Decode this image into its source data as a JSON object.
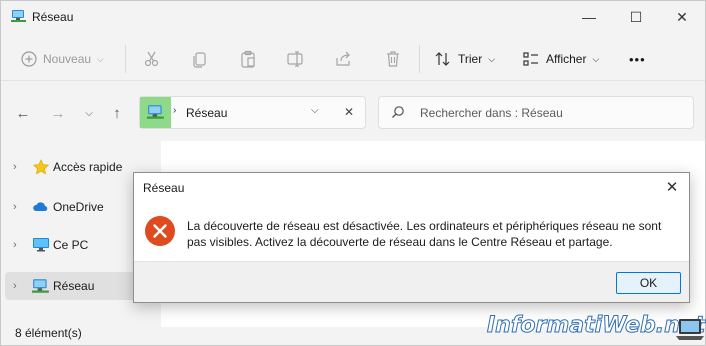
{
  "window": {
    "title": "Réseau",
    "controls": {
      "minimize": "—",
      "maximize": "☐",
      "close": "✕"
    }
  },
  "toolbar": {
    "new_label": "Nouveau",
    "sort_label": "Trier",
    "view_label": "Afficher",
    "more_label": "•••"
  },
  "navigation": {
    "address": "Réseau",
    "search_placeholder": "Rechercher dans : Réseau"
  },
  "sidebar": {
    "items": [
      {
        "label": "Accès rapide",
        "icon": "star-icon"
      },
      {
        "label": "OneDrive",
        "icon": "cloud-icon"
      },
      {
        "label": "Ce PC",
        "icon": "monitor-icon"
      },
      {
        "label": "Réseau",
        "icon": "network-icon",
        "selected": true
      }
    ]
  },
  "status": {
    "item_count": "8 élément(s)"
  },
  "dialog": {
    "title": "Réseau",
    "message": "La découverte de réseau est désactivée. Les ordinateurs et périphériques réseau ne sont pas visibles. Activez la découverte de réseau dans le Centre Réseau et partage.",
    "ok_label": "OK",
    "close_glyph": "✕"
  },
  "watermark": {
    "text": "InformatiWeb.net"
  },
  "colors": {
    "error_red": "#e04a1f",
    "accent_blue": "#0078d7",
    "selected_bg": "#e0e0e0"
  }
}
